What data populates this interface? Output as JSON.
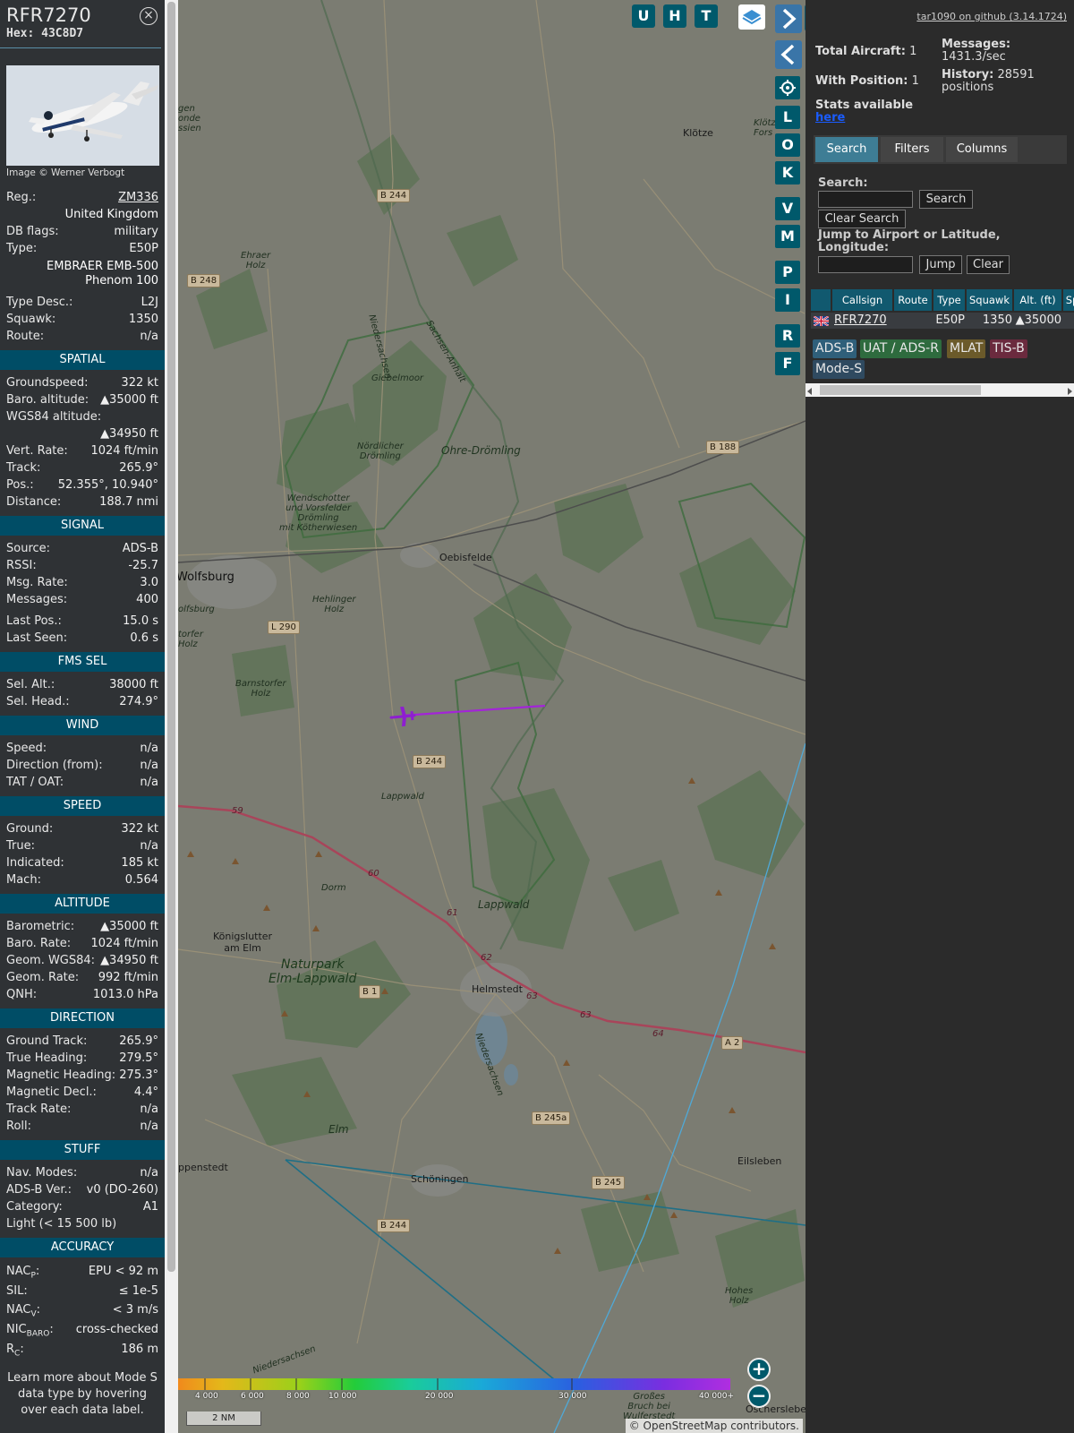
{
  "aircraft": {
    "callsign": "RFR7270",
    "hex_label": "Hex:",
    "hex": "43C8D7",
    "close_glyph": "×",
    "photo_credit": "Image © Werner Verbogt",
    "reg_label": "Reg.:",
    "reg": "ZM336",
    "country": "United Kingdom",
    "dbflags_label": "DB flags:",
    "dbflags": "military",
    "type_label": "Type:",
    "type": "E50P",
    "type_name_1": "EMBRAER EMB-500",
    "type_name_2": "Phenom 100",
    "typedesc_label": "Type Desc.:",
    "typedesc": "L2J",
    "squawk_label": "Squawk:",
    "squawk": "1350",
    "route_label": "Route:",
    "route": "n/a"
  },
  "spatial": {
    "title": "SPATIAL",
    "rows": [
      {
        "k": "Groundspeed:",
        "v": "322 kt"
      },
      {
        "k": "Baro. altitude:",
        "v": "▲35000 ft"
      },
      {
        "k": "WGS84 altitude:",
        "v": ""
      },
      {
        "k": "",
        "v": "▲34950 ft"
      },
      {
        "k": "Vert. Rate:",
        "v": "1024 ft/min"
      },
      {
        "k": "Track:",
        "v": "265.9°"
      },
      {
        "k": "Pos.:",
        "v": "52.355°, 10.940°"
      },
      {
        "k": "Distance:",
        "v": "188.7 nmi"
      }
    ]
  },
  "signal": {
    "title": "SIGNAL",
    "rows": [
      {
        "k": "Source:",
        "v": "ADS-B"
      },
      {
        "k": "RSSI:",
        "v": "-25.7"
      },
      {
        "k": "Msg. Rate:",
        "v": "3.0"
      },
      {
        "k": "Messages:",
        "v": "400"
      }
    ],
    "rows2": [
      {
        "k": "Last Pos.:",
        "v": "15.0 s"
      },
      {
        "k": "Last Seen:",
        "v": "0.6 s"
      }
    ]
  },
  "fms": {
    "title": "FMS SEL",
    "rows": [
      {
        "k": "Sel. Alt.:",
        "v": "38000 ft"
      },
      {
        "k": "Sel. Head.:",
        "v": "274.9°"
      }
    ]
  },
  "wind": {
    "title": "WIND",
    "rows": [
      {
        "k": "Speed:",
        "v": "n/a"
      },
      {
        "k": "Direction (from):",
        "v": "n/a"
      },
      {
        "k": "TAT / OAT:",
        "v": "n/a"
      }
    ]
  },
  "speed": {
    "title": "SPEED",
    "rows": [
      {
        "k": "Ground:",
        "v": "322 kt"
      },
      {
        "k": "True:",
        "v": "n/a"
      },
      {
        "k": "Indicated:",
        "v": "185 kt"
      },
      {
        "k": "Mach:",
        "v": "0.564"
      }
    ]
  },
  "altitude": {
    "title": "ALTITUDE",
    "rows": [
      {
        "k": "Barometric:",
        "v": "▲35000 ft"
      },
      {
        "k": "Baro. Rate:",
        "v": "1024 ft/min"
      },
      {
        "k": "Geom. WGS84:",
        "v": "▲34950 ft"
      },
      {
        "k": "Geom. Rate:",
        "v": "992 ft/min"
      },
      {
        "k": "QNH:",
        "v": "1013.0 hPa"
      }
    ]
  },
  "direction": {
    "title": "DIRECTION",
    "rows": [
      {
        "k": "Ground Track:",
        "v": "265.9°"
      },
      {
        "k": "True Heading:",
        "v": "279.5°"
      },
      {
        "k": "Magnetic Heading:",
        "v": "275.3°"
      },
      {
        "k": "Magnetic Decl.:",
        "v": "4.4°"
      },
      {
        "k": "Track Rate:",
        "v": "n/a"
      },
      {
        "k": "Roll:",
        "v": "n/a"
      }
    ]
  },
  "stuff": {
    "title": "STUFF",
    "rows": [
      {
        "k": "Nav. Modes:",
        "v": "n/a"
      },
      {
        "k": "ADS-B Ver.:",
        "v": "v0 (DO-260)"
      },
      {
        "k": "Category:",
        "v": "A1"
      },
      {
        "k": "Light (< 15 500 lb)",
        "v": ""
      }
    ]
  },
  "accuracy": {
    "title": "ACCURACY",
    "nacp_main": "NAC",
    "nacp_sub": "P",
    "nacp_v": "EPU < 92 m",
    "sil_k": "SIL:",
    "sil_v": "≤ 1e-5",
    "nacv_main": "NAC",
    "nacv_sub": "V",
    "nacv_v": "< 3 m/s",
    "nic_main": "NIC",
    "nic_sub": "BARO",
    "nic_v": "cross-checked",
    "rc_main": "R",
    "rc_sub": "C",
    "rc_v": "186 m",
    "colon": ":"
  },
  "learn_more": "Learn more about Mode S data type by hovering over each data label.",
  "map": {
    "toolbar": [
      "U",
      "H",
      "T"
    ],
    "layer_buttons": [
      "L",
      "O",
      "K",
      "V",
      "M",
      "P",
      "I",
      "R",
      "F"
    ],
    "zoom_in": "+",
    "zoom_out": "−",
    "scale": "2 NM",
    "attribution": "© OpenStreetMap contributors.",
    "alt_legend": [
      "4 000",
      "6 000",
      "8 000",
      "10 000",
      "20 000",
      "30 000",
      "40 000+"
    ],
    "labels": {
      "klotze": "Klötze",
      "klotzer_forst": "Klötz\nFors",
      "ohre": "Ohre-Drömling",
      "nordlicher": "Nördlicher\nDrömling",
      "wendschotter": "Wendschotter\nund Vorsfelder\nDrömling\nmit Kötherwiesen",
      "oebisfelde": "Oebisfelde",
      "wolfsburg": "Wolfsburg",
      "hehlinger": "Hehlinger\nHolz",
      "barnstorfer": "Barnstorfer\nHolz",
      "ehraer": "Ehraer\nHolz",
      "giebelmoor": "Giebelmoor",
      "lappwald_small": "Lappwald",
      "lappwald": "Lappwald",
      "dorm": "Dorm",
      "konigslutter": "Königslutter\nam Elm",
      "naturpark": "Naturpark\nElm-Lappwald",
      "helmstedt": "Helmstedt",
      "elm": "Elm",
      "schoningen": "Schöningen",
      "eilsleben": "Eilsleben",
      "hohes_holz": "Hohes\nHolz",
      "oschersleben": "Oschersleben",
      "grosses_bruch": "Großes\nBruch bei\nWulferstedt",
      "penstedt": "ppenstedt",
      "niedersachsen1": "Niedersachsen",
      "sachsen_anhalt": "Sachsen-Anhalt",
      "niedersachsen2": "Niedersachsen",
      "niedersachsen3": "Niedersachsen",
      "olfsburg": "olfsburg",
      "torfer": "torfer\nHolz",
      "gen": "gen\nonde\nssien"
    },
    "roads": {
      "b244a": "B 244",
      "b248": "B 248",
      "b188": "B 188",
      "l290": "L 290",
      "b244b": "B 244",
      "b1": "B 1",
      "a2": "A 2",
      "b245a": "B 245a",
      "b245": "B 245",
      "b244c": "B 244"
    },
    "km": [
      "59",
      "60",
      "61",
      "62",
      "63",
      "63",
      "64"
    ]
  },
  "sidebar": {
    "github": "tar1090 on github (3.14.1724)",
    "total_label": "Total Aircraft:",
    "total": "1",
    "withpos_label": "With Position:",
    "withpos": "1",
    "messages_label": "Messages:",
    "messages": "1431.3/sec",
    "history_label": "History:",
    "history": "28591",
    "history_unit": "positions",
    "stats_text": "Stats available",
    "stats_link": "here",
    "tabs": [
      "Search",
      "Filters",
      "Columns"
    ],
    "search_label": "Search:",
    "search_button": "Search",
    "clear_search": "Clear Search",
    "jump_label": "Jump to Airport or Latitude, Longitude:",
    "jump_button": "Jump",
    "clear_button": "Clear",
    "columns": [
      "",
      "Callsign",
      "Route",
      "Type",
      "Squawk",
      "Alt. (ft)",
      "Sp"
    ],
    "row": {
      "callsign": "RFR7270",
      "route": "",
      "type": "E50P",
      "squawk": "1350",
      "alt": "▲35000"
    },
    "sources": [
      {
        "label": "ADS-B",
        "bg": "#2f5f7a",
        "fg": "#e8e8e8"
      },
      {
        "label": "UAT / ADS-R",
        "bg": "#2e6b3e",
        "fg": "#e8e8e8"
      },
      {
        "label": "MLAT",
        "bg": "#6b5a2a",
        "fg": "#e8e8e8"
      },
      {
        "label": "TIS-B",
        "bg": "#6b2a3e",
        "fg": "#e8e8e8"
      },
      {
        "label": "Mode-S",
        "bg": "#2f4a60",
        "fg": "#e8e8e8"
      }
    ]
  }
}
